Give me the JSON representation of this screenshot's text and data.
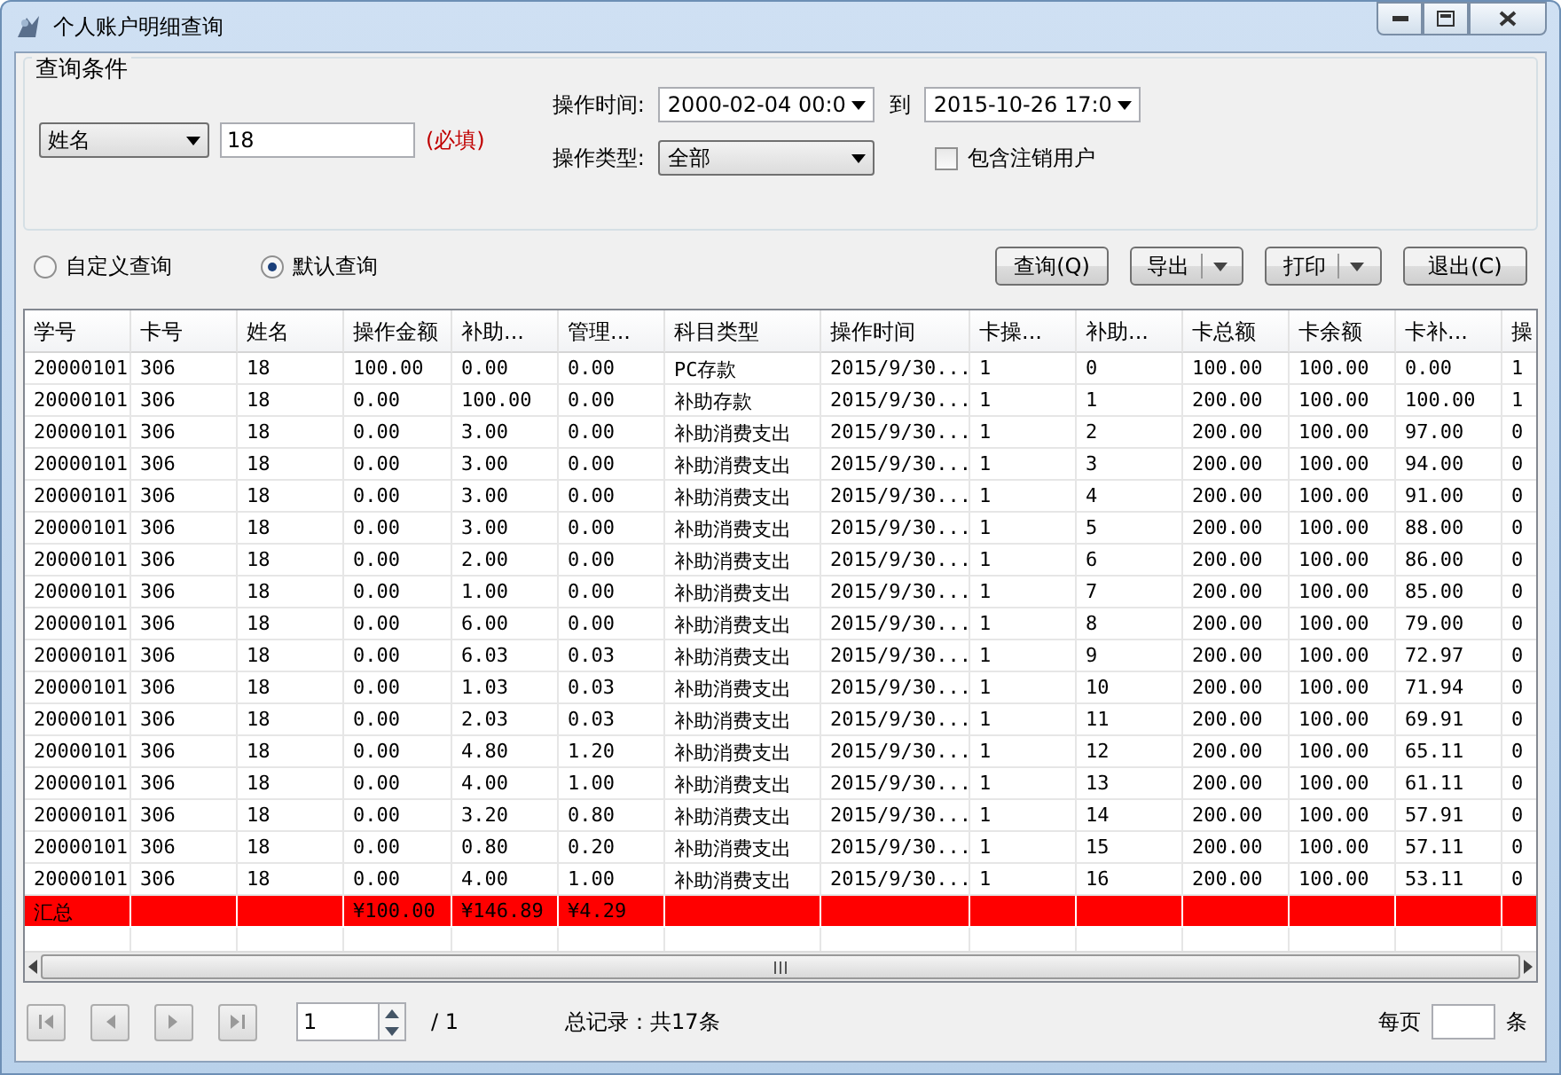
{
  "window": {
    "title": "个人账户明细查询"
  },
  "query": {
    "title": "查询条件",
    "field_select": "姓名",
    "field_value": "18",
    "required_note": "(必填)",
    "time_label": "操作时间:",
    "time_from": "2000-02-04 00:0",
    "time_sep": "到",
    "time_to": "2015-10-26 17:0",
    "type_label": "操作类型:",
    "type_value": "全部",
    "include_cancelled": {
      "label": "包含注销用户",
      "checked": false
    },
    "modes": [
      {
        "label": "自定义查询",
        "selected": false
      },
      {
        "label": "默认查询",
        "selected": true
      }
    ],
    "buttons": [
      {
        "label": "查询(Q)",
        "kind": "plain"
      },
      {
        "label": "导出",
        "kind": "split"
      },
      {
        "label": "打印",
        "kind": "split"
      },
      {
        "label": "退出(C)",
        "kind": "plain"
      }
    ]
  },
  "table": {
    "columns": [
      "学号",
      "卡号",
      "姓名",
      "操作金额",
      "补助...",
      "管理...",
      "科目类型",
      "操作时间",
      "卡操...",
      "补助...",
      "卡总额",
      "卡余额",
      "卡补...",
      "操"
    ],
    "rows": [
      [
        "20000101",
        "306",
        "18",
        "100.00",
        "0.00",
        "0.00",
        "PC存款",
        "2015/9/30...",
        "1",
        "0",
        "100.00",
        "100.00",
        "0.00",
        "1"
      ],
      [
        "20000101",
        "306",
        "18",
        "0.00",
        "100.00",
        "0.00",
        "补助存款",
        "2015/9/30...",
        "1",
        "1",
        "200.00",
        "100.00",
        "100.00",
        "1"
      ],
      [
        "20000101",
        "306",
        "18",
        "0.00",
        "3.00",
        "0.00",
        "补助消费支出",
        "2015/9/30...",
        "1",
        "2",
        "200.00",
        "100.00",
        "97.00",
        "0"
      ],
      [
        "20000101",
        "306",
        "18",
        "0.00",
        "3.00",
        "0.00",
        "补助消费支出",
        "2015/9/30...",
        "1",
        "3",
        "200.00",
        "100.00",
        "94.00",
        "0"
      ],
      [
        "20000101",
        "306",
        "18",
        "0.00",
        "3.00",
        "0.00",
        "补助消费支出",
        "2015/9/30...",
        "1",
        "4",
        "200.00",
        "100.00",
        "91.00",
        "0"
      ],
      [
        "20000101",
        "306",
        "18",
        "0.00",
        "3.00",
        "0.00",
        "补助消费支出",
        "2015/9/30...",
        "1",
        "5",
        "200.00",
        "100.00",
        "88.00",
        "0"
      ],
      [
        "20000101",
        "306",
        "18",
        "0.00",
        "2.00",
        "0.00",
        "补助消费支出",
        "2015/9/30...",
        "1",
        "6",
        "200.00",
        "100.00",
        "86.00",
        "0"
      ],
      [
        "20000101",
        "306",
        "18",
        "0.00",
        "1.00",
        "0.00",
        "补助消费支出",
        "2015/9/30...",
        "1",
        "7",
        "200.00",
        "100.00",
        "85.00",
        "0"
      ],
      [
        "20000101",
        "306",
        "18",
        "0.00",
        "6.00",
        "0.00",
        "补助消费支出",
        "2015/9/30...",
        "1",
        "8",
        "200.00",
        "100.00",
        "79.00",
        "0"
      ],
      [
        "20000101",
        "306",
        "18",
        "0.00",
        "6.03",
        "0.03",
        "补助消费支出",
        "2015/9/30...",
        "1",
        "9",
        "200.00",
        "100.00",
        "72.97",
        "0"
      ],
      [
        "20000101",
        "306",
        "18",
        "0.00",
        "1.03",
        "0.03",
        "补助消费支出",
        "2015/9/30...",
        "1",
        "10",
        "200.00",
        "100.00",
        "71.94",
        "0"
      ],
      [
        "20000101",
        "306",
        "18",
        "0.00",
        "2.03",
        "0.03",
        "补助消费支出",
        "2015/9/30...",
        "1",
        "11",
        "200.00",
        "100.00",
        "69.91",
        "0"
      ],
      [
        "20000101",
        "306",
        "18",
        "0.00",
        "4.80",
        "1.20",
        "补助消费支出",
        "2015/9/30...",
        "1",
        "12",
        "200.00",
        "100.00",
        "65.11",
        "0"
      ],
      [
        "20000101",
        "306",
        "18",
        "0.00",
        "4.00",
        "1.00",
        "补助消费支出",
        "2015/9/30...",
        "1",
        "13",
        "200.00",
        "100.00",
        "61.11",
        "0"
      ],
      [
        "20000101",
        "306",
        "18",
        "0.00",
        "3.20",
        "0.80",
        "补助消费支出",
        "2015/9/30...",
        "1",
        "14",
        "200.00",
        "100.00",
        "57.91",
        "0"
      ],
      [
        "20000101",
        "306",
        "18",
        "0.00",
        "0.80",
        "0.20",
        "补助消费支出",
        "2015/9/30...",
        "1",
        "15",
        "200.00",
        "100.00",
        "57.11",
        "0"
      ],
      [
        "20000101",
        "306",
        "18",
        "0.00",
        "4.00",
        "1.00",
        "补助消费支出",
        "2015/9/30...",
        "1",
        "16",
        "200.00",
        "100.00",
        "53.11",
        "0"
      ]
    ],
    "summary": {
      "label": "汇总",
      "totals": [
        "¥100.00",
        "¥146.89",
        "¥4.29"
      ]
    }
  },
  "pager": {
    "page": "1",
    "pages": "/ 1",
    "total": "总记录：共17条",
    "per_page_label": "每页",
    "per_page_unit": "条"
  }
}
